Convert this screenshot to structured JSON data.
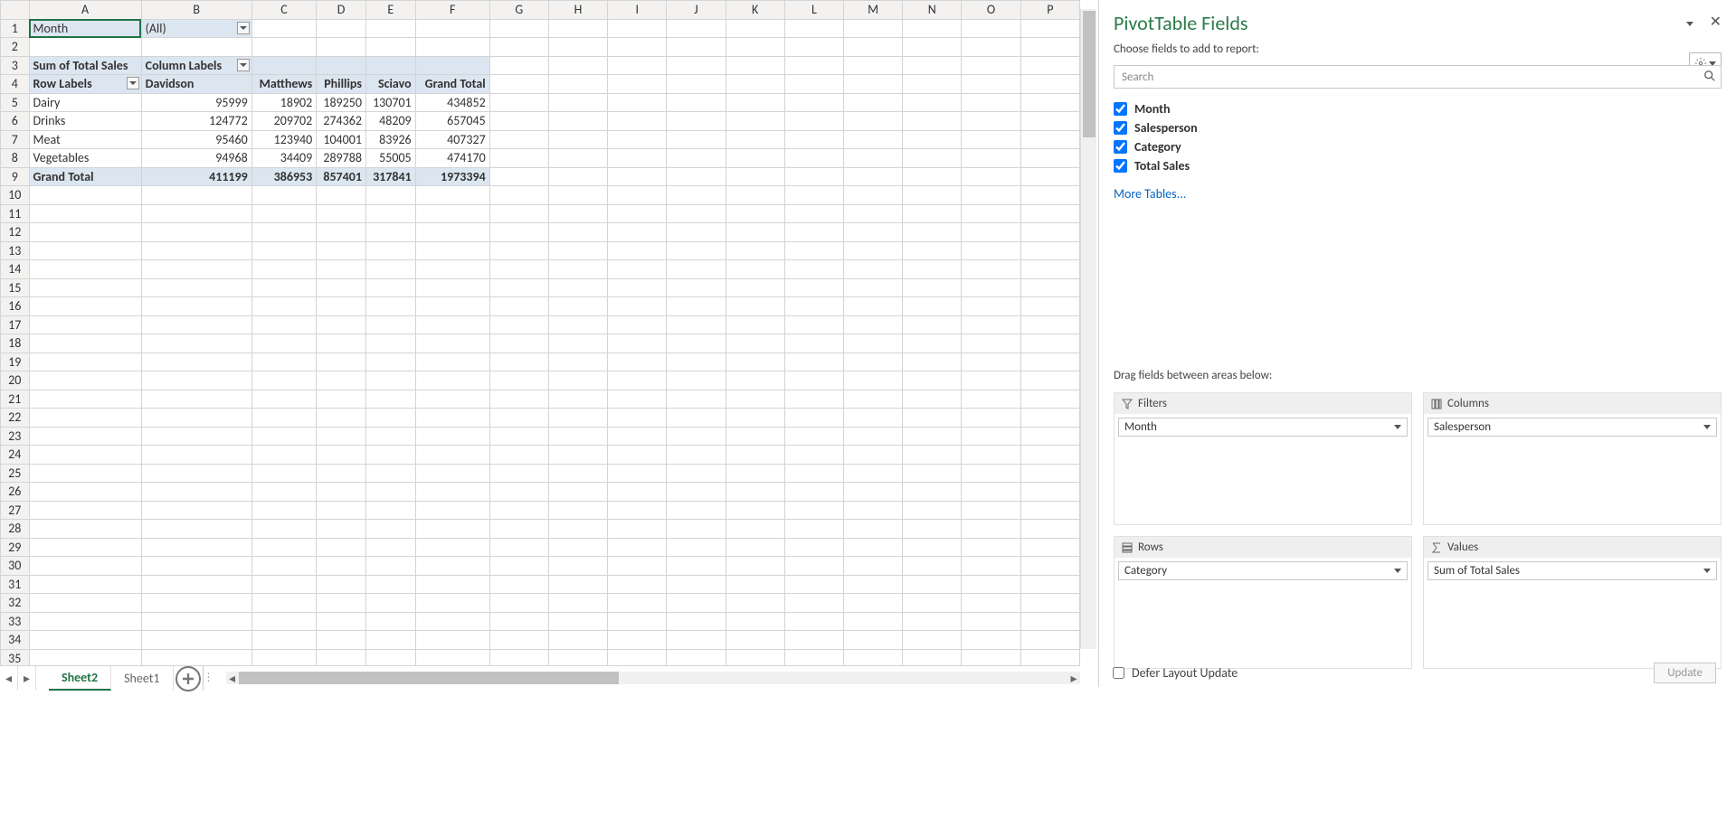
{
  "columns": [
    "A",
    "B",
    "C",
    "D",
    "E",
    "F",
    "G",
    "H",
    "I",
    "J",
    "K",
    "L",
    "M",
    "N",
    "O",
    "P"
  ],
  "rows": 36,
  "filter": {
    "label": "Month",
    "value": "(All)"
  },
  "pivot": {
    "measure": "Sum of Total Sales",
    "col_label": "Column Labels",
    "row_label": "Row Labels",
    "col_headers": [
      "Davidson",
      "Matthews",
      "Phillips",
      "Sciavo",
      "Grand Total"
    ],
    "rows": [
      {
        "label": "Dairy",
        "vals": [
          "95999",
          "18902",
          "189250",
          "130701",
          "434852"
        ]
      },
      {
        "label": "Drinks",
        "vals": [
          "124772",
          "209702",
          "274362",
          "48209",
          "657045"
        ]
      },
      {
        "label": "Meat",
        "vals": [
          "95460",
          "123940",
          "104001",
          "83926",
          "407327"
        ]
      },
      {
        "label": "Vegetables",
        "vals": [
          "94968",
          "34409",
          "289788",
          "55005",
          "474170"
        ]
      }
    ],
    "grand": {
      "label": "Grand Total",
      "vals": [
        "411199",
        "386953",
        "857401",
        "317841",
        "1973394"
      ]
    }
  },
  "pane": {
    "title": "PivotTable Fields",
    "subtitle": "Choose fields to add to report:",
    "search_placeholder": "Search",
    "fields": [
      "Month",
      "Salesperson",
      "Category",
      "Total Sales"
    ],
    "more": "More Tables...",
    "drag_label": "Drag fields between areas below:",
    "areas": {
      "filters": {
        "title": "Filters",
        "item": "Month"
      },
      "columns": {
        "title": "Columns",
        "item": "Salesperson"
      },
      "rows": {
        "title": "Rows",
        "item": "Category"
      },
      "values": {
        "title": "Values",
        "item": "Sum of Total Sales"
      }
    }
  },
  "tabs": {
    "active": "Sheet2",
    "other": "Sheet1"
  },
  "defer": {
    "label": "Defer Layout Update",
    "button": "Update"
  }
}
